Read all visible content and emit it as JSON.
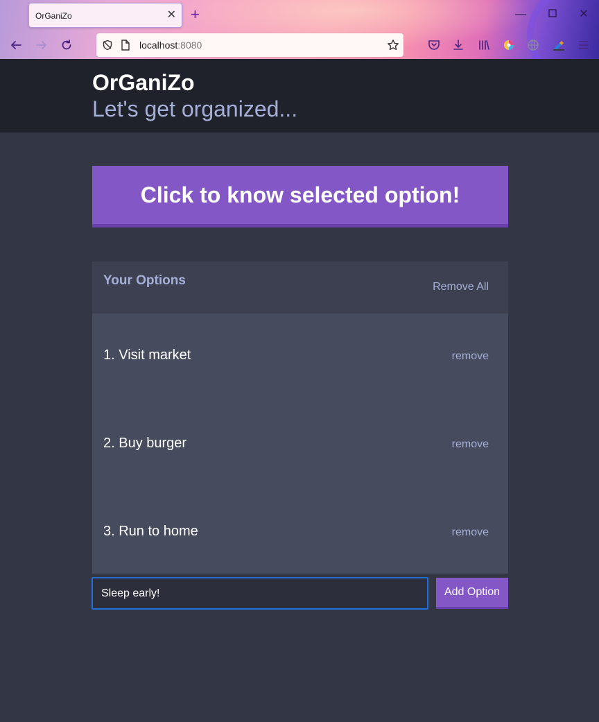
{
  "browser": {
    "tab_title": "OrGaniZo",
    "url_host": "localhost",
    "url_port": ":8080",
    "accent": "#8357c5"
  },
  "header": {
    "title": "OrGaniZo",
    "subtitle": "Let's get organized..."
  },
  "action_button_label": "Click to know selected option!",
  "options_panel": {
    "title": "Your Options",
    "remove_all_label": "Remove All",
    "items": [
      {
        "text": "1. Visit market",
        "remove_label": "remove"
      },
      {
        "text": "2. Buy burger",
        "remove_label": "remove"
      },
      {
        "text": "3. Run to home",
        "remove_label": "remove"
      }
    ]
  },
  "add_form": {
    "input_value": "Sleep early!",
    "button_label": "Add Option"
  }
}
